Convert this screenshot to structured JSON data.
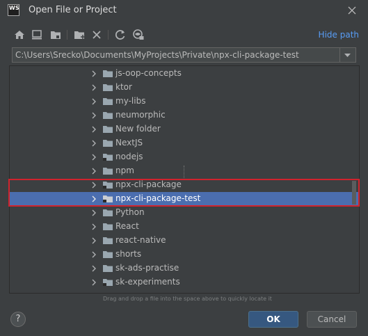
{
  "window": {
    "app_icon_text": "WS",
    "title": "Open File or Project"
  },
  "toolbar": {
    "buttons": [
      {
        "name": "home-icon"
      },
      {
        "name": "desktop-icon"
      },
      {
        "name": "project-folder-icon"
      },
      {
        "name": "new-folder-icon"
      },
      {
        "name": "delete-icon"
      },
      {
        "name": "refresh-icon"
      },
      {
        "name": "show-hidden-icon"
      }
    ],
    "hide_path_label": "Hide path"
  },
  "path": {
    "value": "C:\\Users\\Srecko\\Documents\\MyProjects\\Private\\npx-cli-package-test"
  },
  "tree": {
    "items": [
      {
        "label": "js-oop-concepts",
        "badge": false,
        "selected": false
      },
      {
        "label": "ktor",
        "badge": false,
        "selected": false
      },
      {
        "label": "my-libs",
        "badge": false,
        "selected": false
      },
      {
        "label": "neumorphic",
        "badge": false,
        "selected": false
      },
      {
        "label": "New folder",
        "badge": false,
        "selected": false
      },
      {
        "label": "NextJS",
        "badge": false,
        "selected": false
      },
      {
        "label": "nodejs",
        "badge": true,
        "selected": false
      },
      {
        "label": "npm",
        "badge": false,
        "selected": false
      },
      {
        "label": "npx-cli-package",
        "badge": true,
        "selected": false
      },
      {
        "label": "npx-cli-package-test",
        "badge": true,
        "selected": true
      },
      {
        "label": "Python",
        "badge": false,
        "selected": false
      },
      {
        "label": "React",
        "badge": false,
        "selected": false
      },
      {
        "label": "react-native",
        "badge": false,
        "selected": false
      },
      {
        "label": "shorts",
        "badge": false,
        "selected": false
      },
      {
        "label": "sk-ads-practise",
        "badge": false,
        "selected": false
      },
      {
        "label": "sk-experiments",
        "badge": true,
        "selected": false
      }
    ]
  },
  "hint": "Drag and drop a file into the space above to quickly locate it",
  "footer": {
    "help_label": "?",
    "ok_label": "OK",
    "cancel_label": "Cancel"
  },
  "colors": {
    "background": "#3c3f41",
    "selection": "#4b6eaf",
    "accent_link": "#589df6",
    "highlight_box": "#d0232d",
    "ok_button": "#365880"
  }
}
